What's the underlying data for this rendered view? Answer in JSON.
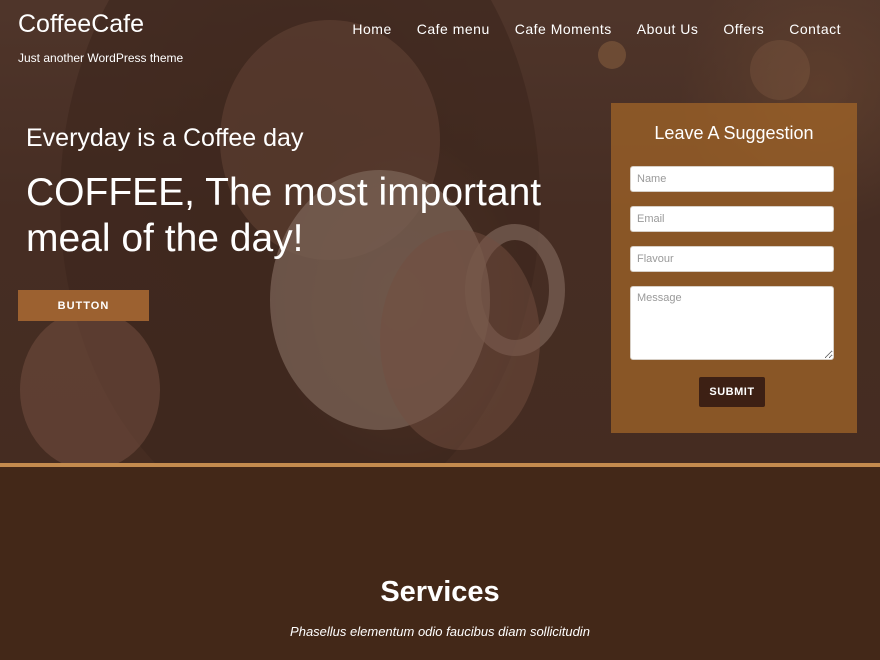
{
  "header": {
    "site_title": "CoffeeCafe",
    "tagline": "Just another WordPress theme"
  },
  "nav": {
    "items": [
      {
        "label": "Home"
      },
      {
        "label": "Cafe menu"
      },
      {
        "label": "Cafe Moments"
      },
      {
        "label": "About Us"
      },
      {
        "label": "Offers"
      },
      {
        "label": "Contact"
      }
    ]
  },
  "hero": {
    "subtitle": "Everyday is a Coffee day",
    "title": "COFFEE, The most important meal of the day!",
    "button_label": "BUTTON"
  },
  "suggestion_form": {
    "title": "Leave A Suggestion",
    "name_placeholder": "Name",
    "email_placeholder": "Email",
    "flavour_placeholder": "Flavour",
    "message_placeholder": "Message",
    "submit_label": "SUBMIT"
  },
  "services": {
    "title": "Services",
    "subtitle": "Phasellus elementum odio faucibus diam sollicitudin"
  },
  "colors": {
    "accent": "#9c6130",
    "border_accent": "#c48b4e",
    "dark_brown": "#432818",
    "submit_bg": "#3d2014"
  }
}
